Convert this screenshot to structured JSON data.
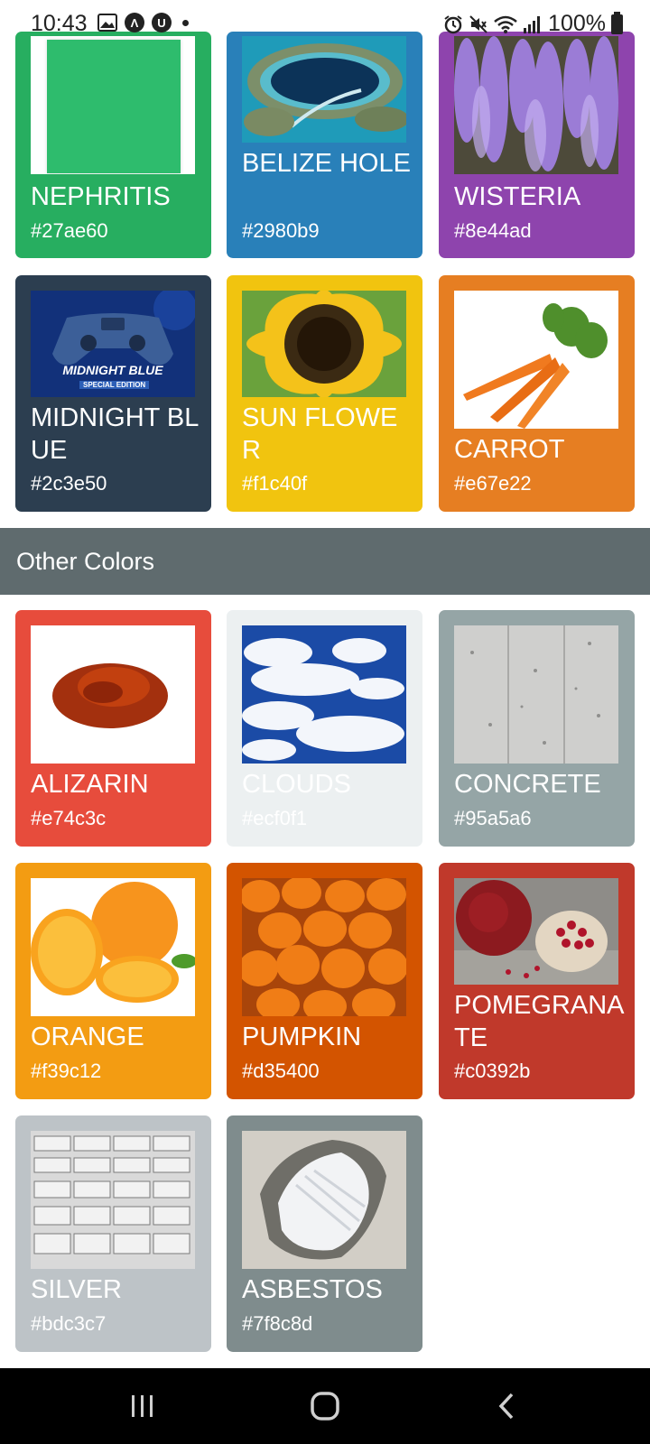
{
  "status_bar": {
    "time": "10:43",
    "battery": "100%",
    "left_icons": [
      "image-icon",
      "a-badge-icon",
      "u-badge-icon",
      "dot-icon"
    ],
    "right_icons": [
      "alarm-icon",
      "mute-icon",
      "wifi-icon",
      "signal-icon",
      "battery-icon"
    ]
  },
  "colors_top": [
    {
      "name": "NEPHRITIS",
      "hex": "#27ae60",
      "image": "nephritis-swatch"
    },
    {
      "name": "BELIZE HOLE",
      "hex": "#2980b9",
      "image": "belize-hole-photo"
    },
    {
      "name": "WISTERIA",
      "hex": "#8e44ad",
      "image": "wisteria-photo"
    },
    {
      "name": "MIDNIGHT BLUE",
      "hex": "#2c3e50",
      "image": "midnight-blue-controller-photo"
    },
    {
      "name": "SUN FLOWER",
      "hex": "#f1c40f",
      "image": "sunflower-photo"
    },
    {
      "name": "CARROT",
      "hex": "#e67e22",
      "image": "carrot-photo"
    }
  ],
  "section": {
    "title": "Other Colors"
  },
  "colors_other": [
    {
      "name": "ALIZARIN",
      "hex": "#e74c3c",
      "image": "alizarin-powder-photo"
    },
    {
      "name": "CLOUDS",
      "hex": "#ecf0f1",
      "image": "clouds-photo"
    },
    {
      "name": "CONCRETE",
      "hex": "#95a5a6",
      "image": "concrete-photo"
    },
    {
      "name": "ORANGE",
      "hex": "#f39c12",
      "image": "orange-photo"
    },
    {
      "name": "PUMPKIN",
      "hex": "#d35400",
      "image": "pumpkin-photo"
    },
    {
      "name": "POMEGRANATE",
      "hex": "#c0392b",
      "image": "pomegranate-photo"
    },
    {
      "name": "SILVER",
      "hex": "#bdc3c7",
      "image": "silver-bars-photo"
    },
    {
      "name": "ASBESTOS",
      "hex": "#7f8c8d",
      "image": "asbestos-photo"
    }
  ],
  "midnight_blue_image_text": {
    "line1": "MIDNIGHT BLUE",
    "line2": "SPECIAL EDITION"
  },
  "nav_bar": {
    "icons": [
      "recent-apps-icon",
      "home-icon",
      "back-icon"
    ]
  }
}
